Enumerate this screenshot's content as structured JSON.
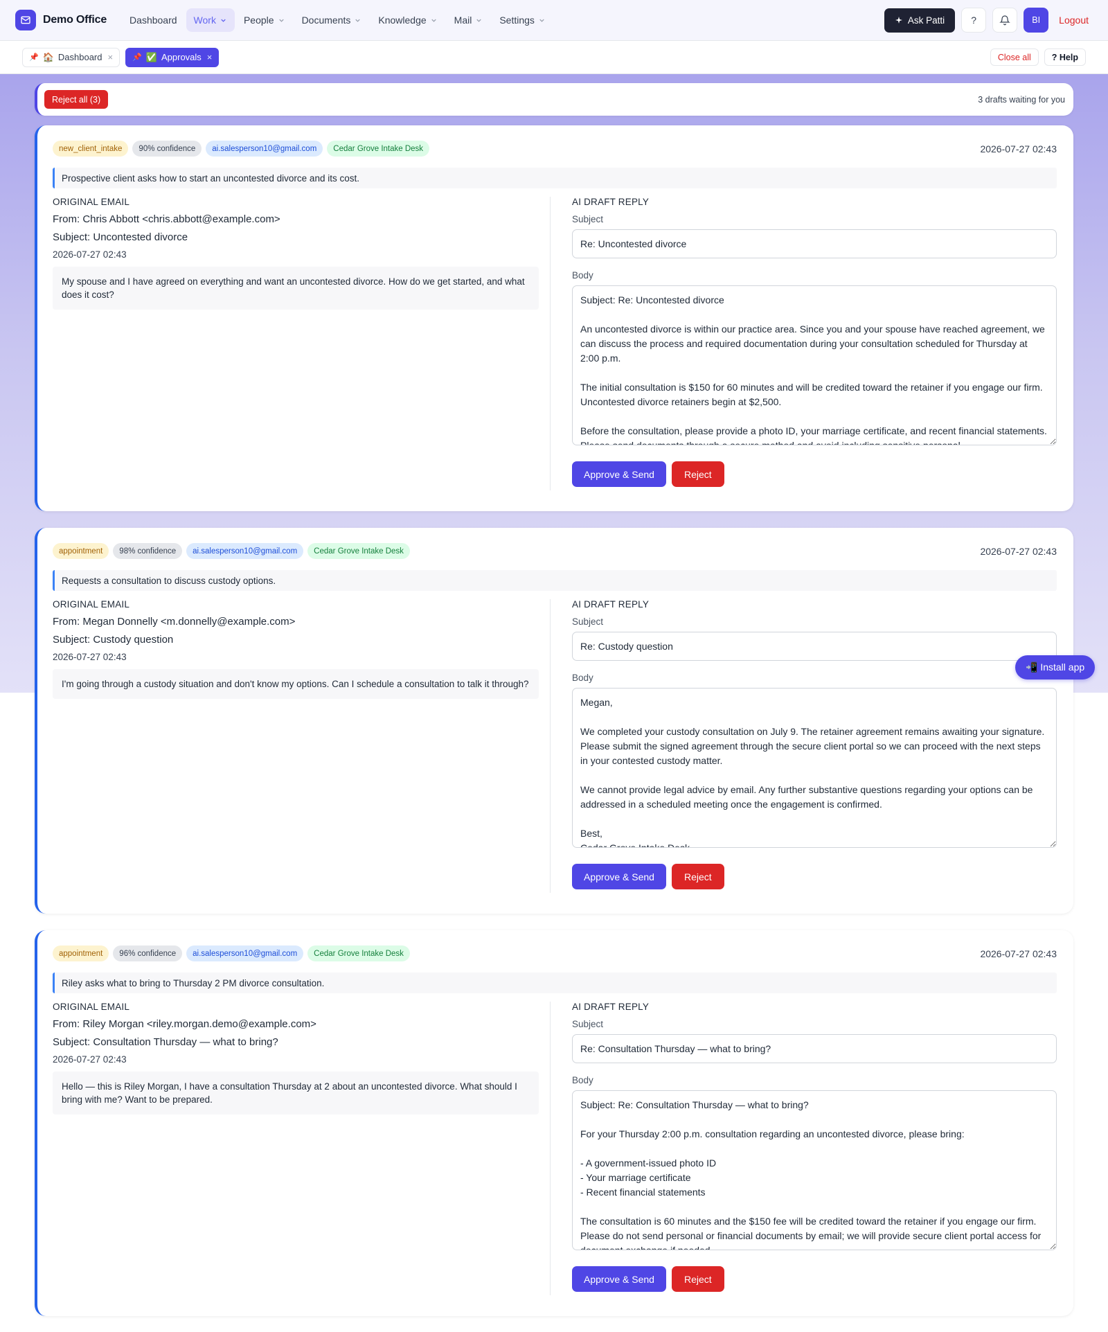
{
  "app": {
    "name": "Demo Office"
  },
  "nav": {
    "items": [
      {
        "label": "Dashboard",
        "has_caret": false
      },
      {
        "label": "Work",
        "has_caret": true,
        "active": true
      },
      {
        "label": "People",
        "has_caret": true
      },
      {
        "label": "Documents",
        "has_caret": true
      },
      {
        "label": "Knowledge",
        "has_caret": true
      },
      {
        "label": "Mail",
        "has_caret": true
      },
      {
        "label": "Settings",
        "has_caret": true
      }
    ],
    "ask_label": "Ask Patti",
    "help_symbol": "?",
    "avatar_initials": "BI",
    "logout_label": "Logout"
  },
  "tabs": {
    "items": [
      {
        "pin": "📌",
        "emoji": "🏠",
        "label": "Dashboard",
        "close": "×",
        "active": false
      },
      {
        "pin": "📌",
        "emoji": "✅",
        "label": "Approvals",
        "close": "×",
        "active": true
      }
    ],
    "close_all_label": "Close all",
    "help_label": "? Help"
  },
  "toolbar": {
    "reject_all_label": "Reject all (3)",
    "drafts_waiting": "3 drafts waiting for you"
  },
  "labels": {
    "original_email": "ORIGINAL EMAIL",
    "ai_draft_reply": "AI DRAFT REPLY",
    "subject": "Subject",
    "body": "Body",
    "approve": "Approve & Send",
    "reject": "Reject"
  },
  "cards": [
    {
      "category": "new_client_intake",
      "confidence": "90% confidence",
      "account": "ai.salesperson10@gmail.com",
      "desk": "Cedar Grove Intake Desk",
      "timestamp": "2026-07-27 02:43",
      "summary": "Prospective client asks how to start an uncontested divorce and its cost.",
      "from": "From: Chris Abbott <chris.abbott@example.com>",
      "subject": "Subject: Uncontested divorce",
      "date": "2026-07-27 02:43",
      "body": "My spouse and I have agreed on everything and want an uncontested divorce. How do we get started, and what does it cost?",
      "reply_subject": "Re: Uncontested divorce",
      "reply_body": "Subject: Re: Uncontested divorce\n\nAn uncontested divorce is within our practice area. Since you and your spouse have reached agreement, we can discuss the process and required documentation during your consultation scheduled for Thursday at 2:00 p.m.\n\nThe initial consultation is $150 for 60 minutes and will be credited toward the retainer if you engage our firm. Uncontested divorce retainers begin at $2,500.\n\nBefore the consultation, please provide a photo ID, your marriage certificate, and recent financial statements. Please send documents through a secure method and avoid including sensitive personal"
    },
    {
      "category": "appointment",
      "confidence": "98% confidence",
      "account": "ai.salesperson10@gmail.com",
      "desk": "Cedar Grove Intake Desk",
      "timestamp": "2026-07-27 02:43",
      "summary": "Requests a consultation to discuss custody options.",
      "from": "From: Megan Donnelly <m.donnelly@example.com>",
      "subject": "Subject: Custody question",
      "date": "2026-07-27 02:43",
      "body": "I'm going through a custody situation and don't know my options. Can I schedule a consultation to talk it through?",
      "reply_subject": "Re: Custody question",
      "reply_body": "Megan,\n\nWe completed your custody consultation on July 9. The retainer agreement remains awaiting your signature. Please submit the signed agreement through the secure client portal so we can proceed with the next steps in your contested custody matter.\n\nWe cannot provide legal advice by email. Any further substantive questions regarding your options can be addressed in a scheduled meeting once the engagement is confirmed.\n\nBest,\nCedar Grove Intake Desk"
    },
    {
      "category": "appointment",
      "confidence": "96% confidence",
      "account": "ai.salesperson10@gmail.com",
      "desk": "Cedar Grove Intake Desk",
      "timestamp": "2026-07-27 02:43",
      "summary": "Riley asks what to bring to Thursday 2 PM divorce consultation.",
      "from": "From: Riley Morgan <riley.morgan.demo@example.com>",
      "subject": "Subject: Consultation Thursday — what to bring?",
      "date": "2026-07-27 02:43",
      "body": "Hello — this is Riley Morgan, I have a consultation Thursday at 2 about an uncontested divorce. What should I bring with me? Want to be prepared.",
      "reply_subject": "Re: Consultation Thursday — what to bring?",
      "reply_body": "Subject: Re: Consultation Thursday — what to bring?\n\nFor your Thursday 2:00 p.m. consultation regarding an uncontested divorce, please bring:\n\n- A government-issued photo ID\n- Your marriage certificate\n- Recent financial statements\n\nThe consultation is 60 minutes and the $150 fee will be credited toward the retainer if you engage our firm. Please do not send personal or financial documents by email; we will provide secure client portal access for document exchange if needed."
    }
  ],
  "install_app_label": "📲 Install app"
}
